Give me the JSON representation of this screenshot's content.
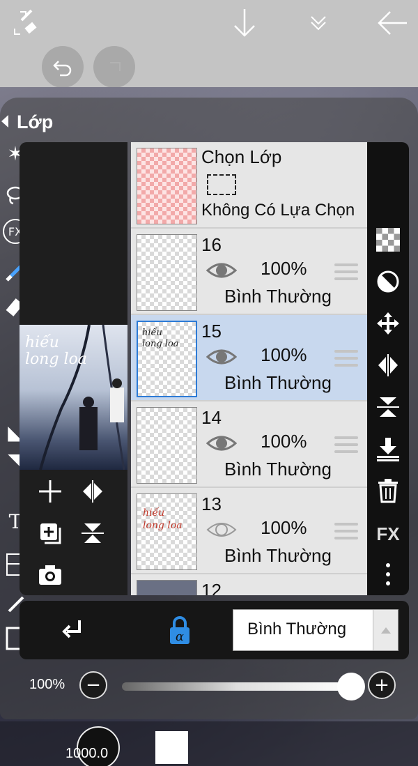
{
  "panel": {
    "title": "Lớp"
  },
  "selection_layer": {
    "title": "Chọn Lớp",
    "status": "Không Có Lựa Chọn"
  },
  "layers": [
    {
      "number": "16",
      "opacity": "100%",
      "blend": "Bình Thường",
      "visible": true,
      "selected": false
    },
    {
      "number": "15",
      "opacity": "100%",
      "blend": "Bình Thường",
      "visible": true,
      "selected": true
    },
    {
      "number": "14",
      "opacity": "100%",
      "blend": "Bình Thường",
      "visible": true,
      "selected": false
    },
    {
      "number": "13",
      "opacity": "100%",
      "blend": "Bình Thường",
      "visible": false,
      "selected": false
    },
    {
      "number": "12"
    }
  ],
  "thumb_texts": {
    "script": "hiếu long loa"
  },
  "blend_mode": {
    "value": "Bình Thường"
  },
  "layer_opacity": {
    "label": "100%",
    "value": 1.0
  },
  "footer": {
    "brush_size": "1000.0",
    "color": "#ffffff"
  },
  "colors": {
    "selected_row": "#c8d8ee",
    "accent": "#2d7bd6",
    "alpha_lock": "#2f8de4"
  }
}
